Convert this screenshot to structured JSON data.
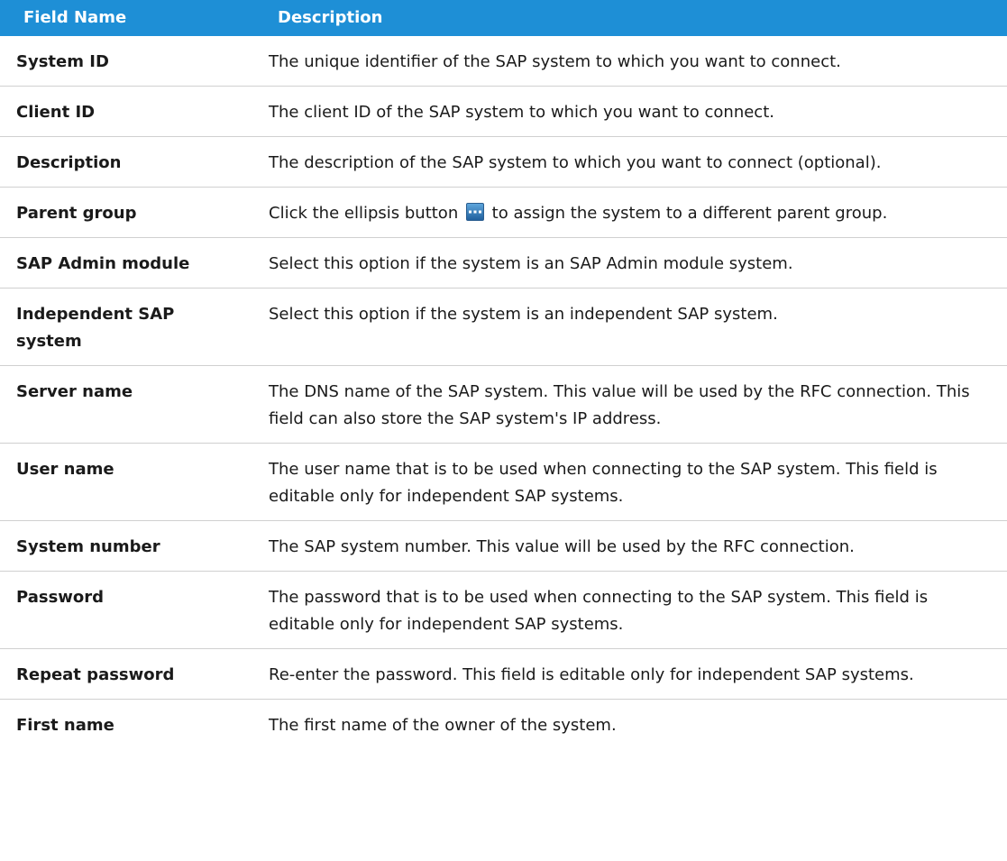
{
  "header": {
    "field_name": "Field Name",
    "description": "Description"
  },
  "rows": [
    {
      "name": "System ID",
      "description": "The unique identifier of the SAP system to which you want to connect."
    },
    {
      "name": "Client ID",
      "description": "The client ID of the SAP system to which you want to connect."
    },
    {
      "name": "Description",
      "description": "The description of the SAP system to which you want to connect (optional)."
    },
    {
      "name": "Parent group",
      "description_before": "Click the ellipsis button",
      "description_after": "to assign the system to a different parent group.",
      "icon": "ellipsis-button-icon"
    },
    {
      "name": "SAP Admin module",
      "description": "Select this option if the system is an SAP Admin module system."
    },
    {
      "name": "Independent SAP system",
      "description": "Select this option if the system is an independent SAP system."
    },
    {
      "name": "Server name",
      "description": "The DNS name of the SAP system. This value will be used by the RFC connection. This field can also store the SAP system's IP address."
    },
    {
      "name": "User name",
      "description": "The user name that is to be used when connecting to the SAP system. This field is editable only for independent SAP systems."
    },
    {
      "name": "System number",
      "description": "The SAP system number. This value will be used by the RFC connection."
    },
    {
      "name": "Password",
      "description": "The password that is to be used when connecting to the SAP system. This field is editable only for independent SAP systems."
    },
    {
      "name": "Repeat password",
      "description": "Re-enter the password. This field is editable only for independent SAP systems."
    },
    {
      "name": "First name",
      "description": "The first name of the owner of the system."
    }
  ],
  "colors": {
    "header_bg": "#1e8fd6",
    "header_text": "#ffffff",
    "row_border": "#d0d0d0"
  }
}
